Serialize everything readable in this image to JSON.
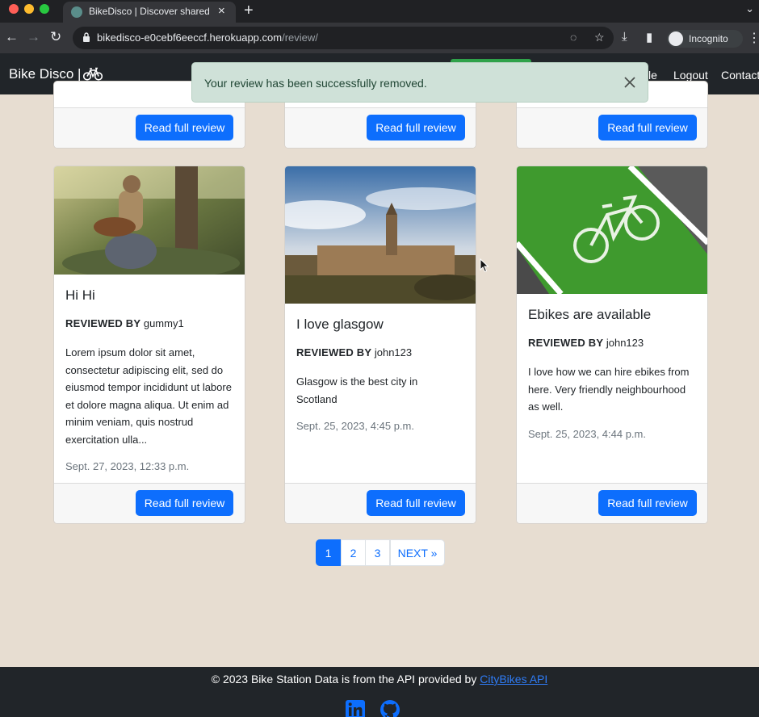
{
  "browser": {
    "tab_title": "BikeDisco | Discover shared bi",
    "url_host": "bikedisco-e0cebf6eeccf.herokuapp.com",
    "url_path": "/review/",
    "profile_label": "Incognito"
  },
  "navbar": {
    "brand": "Bike Disco |",
    "links": [
      "file",
      "Logout",
      "Contact"
    ]
  },
  "alert": {
    "message": "Your review has been successfully removed."
  },
  "top_row": {
    "button_label": "Read full review"
  },
  "cards": [
    {
      "title": "Hi Hi",
      "reviewed_by_label": "REVIEWED BY",
      "author": "gummy1",
      "body": "Lorem ipsum dolor sit amet, consectetur adipiscing elit, sed do eiusmod tempor incididunt ut labore et dolore magna aliqua. Ut enim ad minim veniam, quis nostrud exercitation ulla...",
      "date": "Sept. 27, 2023, 12:33 p.m.",
      "button": "Read full review"
    },
    {
      "title": "I love glasgow",
      "reviewed_by_label": "REVIEWED BY",
      "author": "john123",
      "body": "Glasgow is the best city in Scotland",
      "date": "Sept. 25, 2023, 4:45 p.m.",
      "button": "Read full review"
    },
    {
      "title": "Ebikes are available",
      "reviewed_by_label": "REVIEWED BY",
      "author": "john123",
      "body": "I love how we can hire ebikes from here. Very friendly neighbourhood as well.",
      "date": "Sept. 25, 2023, 4:44 p.m.",
      "button": "Read full review"
    }
  ],
  "pagination": {
    "pages": [
      "1",
      "2",
      "3"
    ],
    "active_page": "1",
    "next_label": "NEXT »"
  },
  "footer": {
    "text": "© 2023 Bike Station Data is from the API provided by",
    "link_text": "CityBikes API"
  },
  "colors": {
    "page_bg": "#e7ddd1",
    "navbar_bg": "#212529",
    "primary": "#0d6efd",
    "alert_bg": "#cfe1d8"
  }
}
